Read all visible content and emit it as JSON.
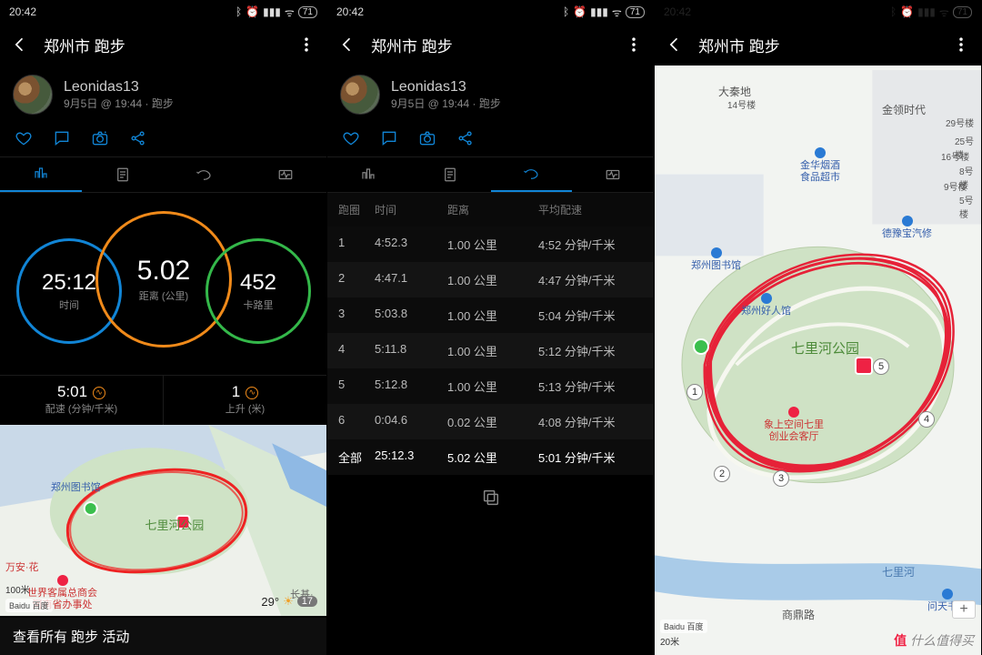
{
  "status": {
    "time": "20:42",
    "battery": "71"
  },
  "appbar": {
    "title": "郑州市 跑步"
  },
  "user": {
    "name": "Leonidas13",
    "meta": "9月5日 @ 19:44 · 跑步"
  },
  "summary": {
    "distance": {
      "value": "5.02",
      "label": "距离 (公里)"
    },
    "time": {
      "value": "25:12",
      "label": "时间"
    },
    "calories": {
      "value": "452",
      "label": "卡路里"
    },
    "pace": {
      "value": "5:01",
      "label": "配速 (分钟/千米)"
    },
    "ascent": {
      "value": "1",
      "label": "上升 (米)"
    }
  },
  "laps": {
    "headers": {
      "lap": "跑圈",
      "time": "时间",
      "dist": "距离",
      "pace": "平均配速"
    },
    "rows": [
      {
        "lap": "1",
        "time": "4:52.3",
        "dist": "1.00 公里",
        "pace": "4:52 分钟/千米"
      },
      {
        "lap": "2",
        "time": "4:47.1",
        "dist": "1.00 公里",
        "pace": "4:47 分钟/千米"
      },
      {
        "lap": "3",
        "time": "5:03.8",
        "dist": "1.00 公里",
        "pace": "5:04 分钟/千米"
      },
      {
        "lap": "4",
        "time": "5:11.8",
        "dist": "1.00 公里",
        "pace": "5:12 分钟/千米"
      },
      {
        "lap": "5",
        "time": "5:12.8",
        "dist": "1.00 公里",
        "pace": "5:13 分钟/千米"
      },
      {
        "lap": "6",
        "time": "0:04.6",
        "dist": "0.02 公里",
        "pace": "4:08 分钟/千米"
      }
    ],
    "total": {
      "lap": "全部",
      "time": "25:12.3",
      "dist": "5.02 公里",
      "pace": "5:01 分钟/千米"
    }
  },
  "map": {
    "park": "七里河公园",
    "library": "郑州图书馆",
    "library2": "郑州好人馆",
    "poi1": "大秦地",
    "poi2": "金领时代",
    "poi3": "金华烟酒\n食品超市",
    "poi4": "德豫宝汽修",
    "poi5": "商鼎路",
    "poi6": "问天书居",
    "poi7": "长基·",
    "poi8": "万安·花",
    "poi_club": "世界客属总商会\n河南省办事处",
    "poi_chuangye": "象上空间七里\n创业会客厅",
    "poi_river": "七里河",
    "b14": "14号楼",
    "b29": "29号楼",
    "b25": "25号楼",
    "b16": "16号楼",
    "b8": "8号楼",
    "b5": "5号楼",
    "b9": "9号楼",
    "scale_big": "20米",
    "scale_small": "100米",
    "credit": "Baidu 百度"
  },
  "weather": {
    "temp": "29°",
    "low": "17"
  },
  "footer": {
    "view_all": "查看所有 跑步 活动"
  },
  "watermark": "什么值得买",
  "chart_data": {
    "type": "table",
    "title": "跑圈",
    "columns": [
      "跑圈",
      "时间",
      "距离(公里)",
      "平均配速(分钟/千米)"
    ],
    "rows": [
      [
        "1",
        "4:52.3",
        1.0,
        "4:52"
      ],
      [
        "2",
        "4:47.1",
        1.0,
        "4:47"
      ],
      [
        "3",
        "5:03.8",
        1.0,
        "5:04"
      ],
      [
        "4",
        "5:11.8",
        1.0,
        "5:12"
      ],
      [
        "5",
        "5:12.8",
        1.0,
        "5:13"
      ],
      [
        "6",
        "0:04.6",
        0.02,
        "4:08"
      ],
      [
        "全部",
        "25:12.3",
        5.02,
        "5:01"
      ]
    ]
  }
}
